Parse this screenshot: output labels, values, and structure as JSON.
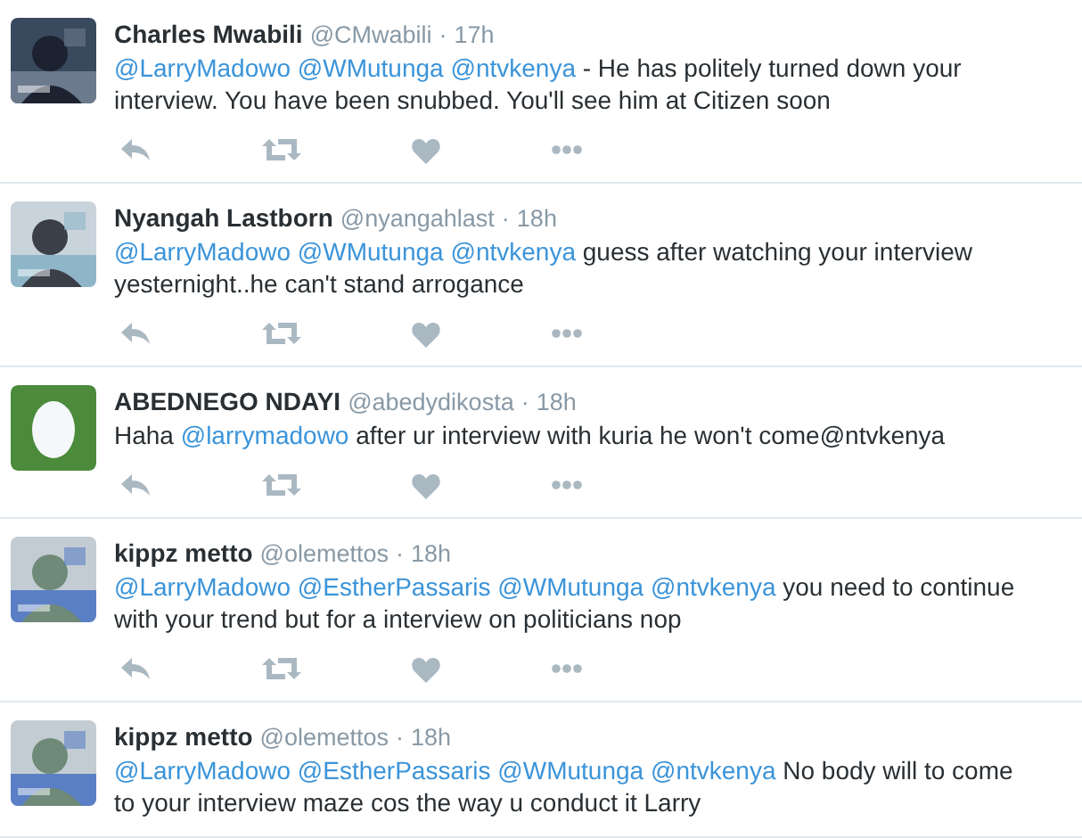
{
  "tweets": [
    {
      "avatar": {
        "kind": "picture"
      },
      "name": "Charles Mwabili",
      "handle": "@CMwabili",
      "separator": "·",
      "time": "17h",
      "show_actions": true,
      "text": [
        {
          "kind": "mention",
          "text": "@LarryMadowo"
        },
        {
          "kind": "mention",
          "text": "@WMutunga"
        },
        {
          "kind": "mention",
          "text": "@ntvkenya"
        },
        {
          "kind": "text",
          "text": " - He has politely turned down your interview. You have been snubbed. You'll see him at Citizen soon"
        }
      ]
    },
    {
      "avatar": {
        "kind": "picture"
      },
      "name": "Nyangah Lastborn",
      "handle": "@nyangahlast",
      "separator": "·",
      "time": "18h",
      "show_actions": true,
      "text": [
        {
          "kind": "mention",
          "text": "@LarryMadowo"
        },
        {
          "kind": "mention",
          "text": "@WMutunga"
        },
        {
          "kind": "mention",
          "text": "@ntvkenya"
        },
        {
          "kind": "text",
          "text": " guess after watching your interview yesternight..he can't stand arrogance"
        }
      ]
    },
    {
      "avatar": {
        "kind": "egg"
      },
      "name": "ABEDNEGO NDAYI",
      "handle": "@abedydikosta",
      "separator": "·",
      "time": "18h",
      "show_actions": true,
      "text": [
        {
          "kind": "text",
          "text": "Haha "
        },
        {
          "kind": "mention",
          "text": "@larrymadowo"
        },
        {
          "kind": "text",
          "text": " after ur interview with kuria he won't come@ntvkenya"
        }
      ]
    },
    {
      "avatar": {
        "kind": "picture"
      },
      "name": "kippz metto",
      "handle": "@olemettos",
      "separator": "·",
      "time": "18h",
      "show_actions": true,
      "text": [
        {
          "kind": "mention",
          "text": "@LarryMadowo"
        },
        {
          "kind": "mention",
          "text": "@EstherPassaris"
        },
        {
          "kind": "mention",
          "text": "@WMutunga"
        },
        {
          "kind": "mention",
          "text": "@ntvkenya"
        },
        {
          "kind": "text",
          "text": " you need to continue with your trend but for a interview on politicians nop"
        }
      ]
    },
    {
      "avatar": {
        "kind": "picture"
      },
      "name": "kippz metto",
      "handle": "@olemettos",
      "separator": "·",
      "time": "18h",
      "show_actions": false,
      "text": [
        {
          "kind": "mention",
          "text": "@LarryMadowo"
        },
        {
          "kind": "mention",
          "text": "@EstherPassaris"
        },
        {
          "kind": "mention",
          "text": "@WMutunga"
        },
        {
          "kind": "mention",
          "text": "@ntvkenya"
        },
        {
          "kind": "text",
          "text": " No body will to come to your interview maze cos the way u conduct it Larry"
        }
      ]
    }
  ]
}
